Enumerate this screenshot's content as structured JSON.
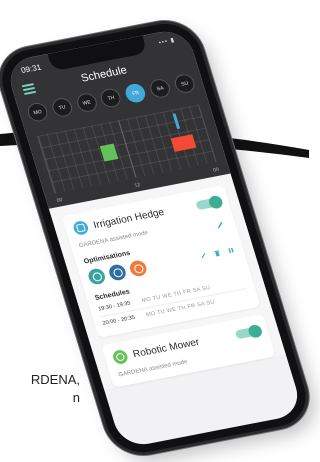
{
  "page": {
    "caption_lines": [
      "RDENA,",
      "n"
    ]
  },
  "status_bar": {
    "time": "09:31",
    "indicators": "••• ▮"
  },
  "header": {
    "title": "Schedule"
  },
  "days": [
    {
      "label": "MO",
      "active": false
    },
    {
      "label": "TU",
      "active": false
    },
    {
      "label": "WE",
      "active": false
    },
    {
      "label": "TH",
      "active": false
    },
    {
      "label": "FR",
      "active": true
    },
    {
      "label": "SA",
      "active": false
    },
    {
      "label": "SU",
      "active": false
    }
  ],
  "grid": {
    "tick_left": "00",
    "tick_mid": "12",
    "tick_right": "00"
  },
  "devices": [
    {
      "name": "Irrigation Hedge",
      "mode": "GARDENA assisted mode",
      "enabled": true,
      "icon": "valve-icon",
      "color": "#3fa9d8"
    },
    {
      "name": "Robotic Mower",
      "mode": "GARDENA assisted mode",
      "enabled": true,
      "icon": "mower-icon",
      "color": "#63c25a"
    }
  ],
  "optimisations": {
    "title": "Optimisations",
    "items": [
      {
        "icon": "wind-icon",
        "color": "#3aa5a0"
      },
      {
        "icon": "rain-icon",
        "color": "#2f6ea4"
      },
      {
        "icon": "sun-icon",
        "color": "#f07a3a"
      }
    ]
  },
  "schedules": {
    "title": "Schedules",
    "rows": [
      {
        "time": "19:30 - 19:35",
        "days": "MO TU WE TH FR SA SU"
      },
      {
        "time": "20:00 - 20:35",
        "days": "MO TU WE TH FR SA SU"
      }
    ]
  },
  "colors": {
    "accent": "#3cae92",
    "header_bg": "#333335",
    "active_day": "#3fa9d8"
  }
}
